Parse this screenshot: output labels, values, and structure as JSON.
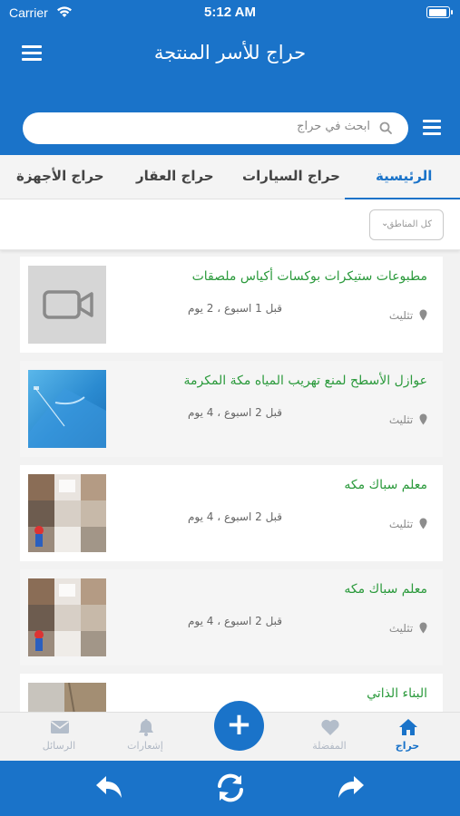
{
  "status": {
    "carrier": "Carrier",
    "time": "5:12 AM"
  },
  "header": {
    "title": "حراج للأسر المنتجة"
  },
  "search": {
    "placeholder": "ابحث في حراج"
  },
  "tabs": [
    {
      "label": "الرئيسية",
      "active": true
    },
    {
      "label": "حراج السيارات"
    },
    {
      "label": "حراج العقار"
    },
    {
      "label": "حراج الأجهزة"
    }
  ],
  "filter": {
    "region": "كل المناطق"
  },
  "listings": [
    {
      "title": "مطبوعات ستيكرات بوكسات أكياس ملصقات",
      "time": "قبل 1 اسبوع ، 2 يوم",
      "location": "تثليث",
      "thumb": "video-placeholder"
    },
    {
      "title": "عوازل الأسطح لمنع تهريب المياه مكة المكرمة",
      "time": "قبل 2 اسبوع ، 4 يوم",
      "location": "تثليث",
      "thumb": "blue-roof-photo"
    },
    {
      "title": "معلم سباك مكه",
      "time": "قبل 2 اسبوع ، 4 يوم",
      "location": "تثليث",
      "thumb": "bathroom-collage"
    },
    {
      "title": "معلم سباك مكه",
      "time": "قبل 2 اسبوع ، 4 يوم",
      "location": "تثليث",
      "thumb": "bathroom-collage"
    },
    {
      "title": "البناء الذاتي",
      "time": "",
      "location": "",
      "thumb": "construction-photo"
    }
  ],
  "tabbar": {
    "home": "حراج",
    "favorites": "المفضلة",
    "notifications": "إشعارات",
    "messages": "الرسائل",
    "add": "+"
  },
  "colors": {
    "primary": "#1a73c9",
    "title_green": "#2b9a3c"
  },
  "icons": [
    "menu-icon",
    "search-icon",
    "home-icon",
    "heart-icon",
    "bell-icon",
    "envelope-icon",
    "back-arrow-icon",
    "refresh-icon",
    "forward-arrow-icon",
    "location-pin-icon",
    "video-camera-icon"
  ]
}
